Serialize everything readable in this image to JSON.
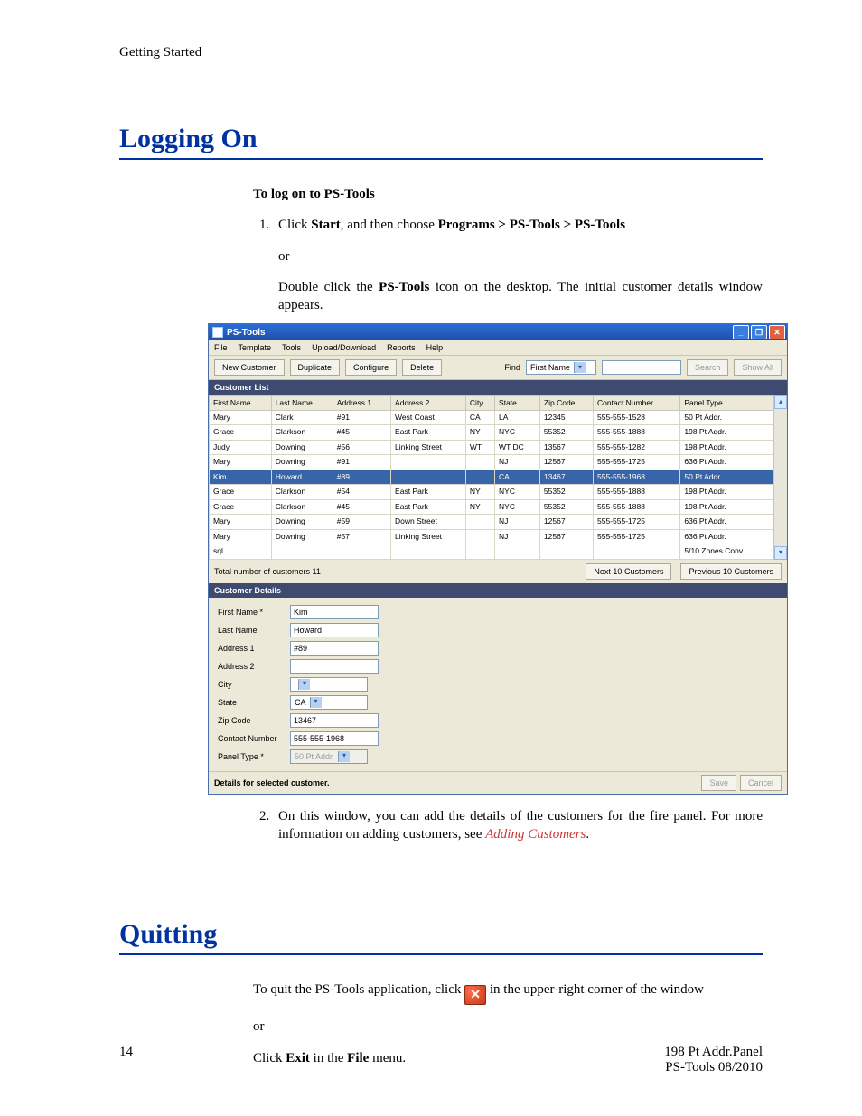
{
  "running_head": "Getting Started",
  "section1": {
    "title": "Logging On",
    "intro": "To log on to PS-Tools",
    "step1_pre": "Click ",
    "step1_b1": "Start",
    "step1_mid": ", and then choose ",
    "step1_b2": "Programs > PS-Tools > PS-Tools",
    "or": "or",
    "step1b_pre": "Double click the ",
    "step1b_b": "PS-Tools",
    "step1b_post": " icon on the desktop. The initial customer details window appears.",
    "step2": "On this window, you can add the details of the customers for the fire panel. For more information on adding customers, see ",
    "step2_link": "Adding Customers",
    "step2_post": "."
  },
  "app": {
    "title": "PS-Tools",
    "menus": [
      "File",
      "Template",
      "Tools",
      "Upload/Download",
      "Reports",
      "Help"
    ],
    "toolbar": {
      "new": "New Customer",
      "dup": "Duplicate",
      "cfg": "Configure",
      "del": "Delete",
      "find_lbl": "Find",
      "find_field": "First Name",
      "search": "Search",
      "showall": "Show All"
    },
    "list_header": "Customer List",
    "columns": [
      "First Name",
      "Last Name",
      "Address 1",
      "Address 2",
      "City",
      "State",
      "Zip Code",
      "Contact Number",
      "Panel Type"
    ],
    "rows": [
      [
        "Mary",
        "Clark",
        "#91",
        "West Coast",
        "CA",
        "LA",
        "12345",
        "555-555-1528",
        "50 Pt Addr."
      ],
      [
        "Grace",
        "Clarkson",
        "#45",
        "East Park",
        "NY",
        "NYC",
        "55352",
        "555-555-1888",
        "198 Pt Addr."
      ],
      [
        "Judy",
        "Downing",
        "#56",
        "Linking Street",
        "WT",
        "WT DC",
        "13567",
        "555-555-1282",
        "198 Pt Addr."
      ],
      [
        "Mary",
        "Downing",
        "#91",
        "",
        "",
        "NJ",
        "12567",
        "555-555-1725",
        "636 Pt Addr."
      ],
      [
        "Kim",
        "Howard",
        "#89",
        "",
        "",
        "CA",
        "13467",
        "555-555-1968",
        "50 Pt Addr."
      ],
      [
        "Grace",
        "Clarkson",
        "#54",
        "East Park",
        "NY",
        "NYC",
        "55352",
        "555-555-1888",
        "198 Pt Addr."
      ],
      [
        "Grace",
        "Clarkson",
        "#45",
        "East Park",
        "NY",
        "NYC",
        "55352",
        "555-555-1888",
        "198 Pt Addr."
      ],
      [
        "Mary",
        "Downing",
        "#59",
        "Down Street",
        "",
        "NJ",
        "12567",
        "555-555-1725",
        "636 Pt Addr."
      ],
      [
        "Mary",
        "Downing",
        "#57",
        "Linking Street",
        "",
        "NJ",
        "12567",
        "555-555-1725",
        "636 Pt Addr."
      ],
      [
        "sql",
        "",
        "",
        "",
        "",
        "",
        "",
        "",
        "5/10 Zones Conv."
      ]
    ],
    "selected_index": 4,
    "total": "Total number of customers 11",
    "next": "Next 10 Customers",
    "prev": "Previous 10 Customers",
    "details_header": "Customer Details",
    "form": {
      "first_lbl": "First Name *",
      "first": "Kim",
      "last_lbl": "Last Name",
      "last": "Howard",
      "a1_lbl": "Address 1",
      "a1": "#89",
      "a2_lbl": "Address 2",
      "a2": "",
      "city_lbl": "City",
      "city": "",
      "state_lbl": "State",
      "state": "CA",
      "zip_lbl": "Zip Code",
      "zip": "13467",
      "cn_lbl": "Contact Number",
      "cn": "555-555-1968",
      "pt_lbl": "Panel Type *",
      "pt": "50 Pt Addr."
    },
    "status": "Details for selected customer.",
    "save": "Save",
    "cancel": "Cancel"
  },
  "section2": {
    "title": "Quitting",
    "line1_pre": "To quit the PS-Tools application, click ",
    "line1_post": " in the upper-right corner of the window",
    "or": "or",
    "line2_pre": "Click ",
    "line2_b1": "Exit",
    "line2_mid": " in the ",
    "line2_b2": "File",
    "line2_post": " menu."
  },
  "footer": {
    "page": "14",
    "r1": "198 Pt Addr.Panel",
    "r2": "PS-Tools 08/2010"
  }
}
